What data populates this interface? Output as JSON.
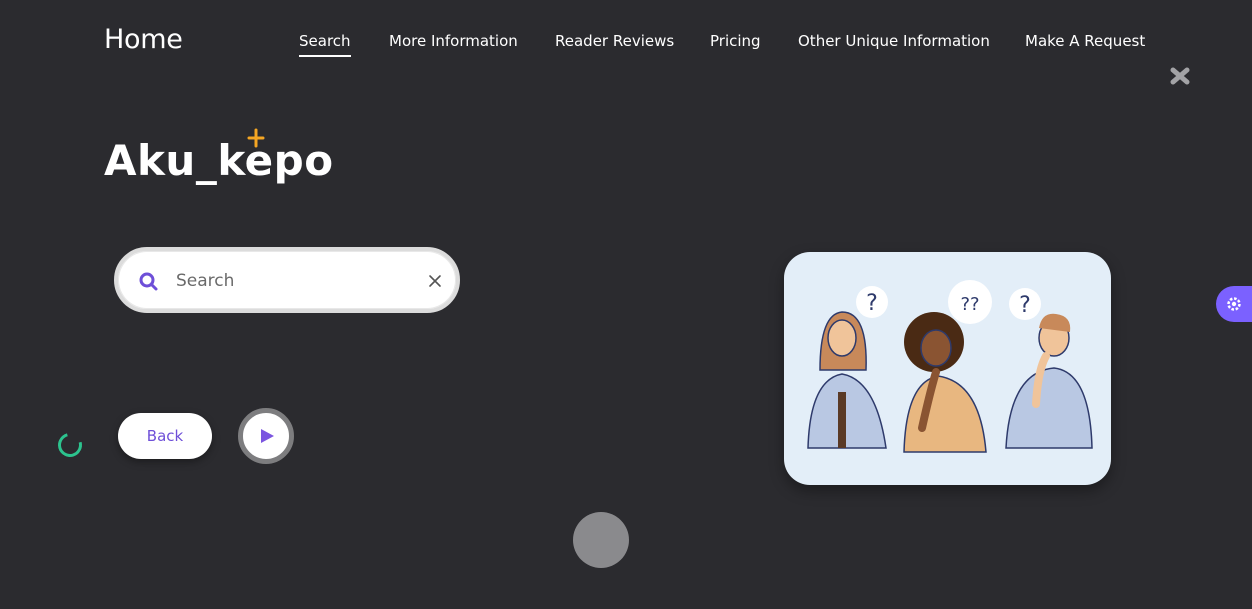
{
  "brand": "Home",
  "nav": [
    {
      "label": "Search",
      "active": true
    },
    {
      "label": "More Information"
    },
    {
      "label": "Reader Reviews"
    },
    {
      "label": "Pricing"
    },
    {
      "label": "Other Unique Information"
    },
    {
      "label": "Make A Request"
    }
  ],
  "title": "Aku_kepo",
  "search": {
    "placeholder": "Search",
    "value": ""
  },
  "back_button": "Back",
  "colors": {
    "accent": "#7b61ff",
    "spinner": "#2cc38e",
    "deco_plus": "#f5a623",
    "background": "#2b2b2f"
  },
  "icons": [
    "close-x-icon",
    "plus-sparkle-icon",
    "search-icon",
    "clear-icon",
    "play-icon",
    "gear-icon"
  ]
}
